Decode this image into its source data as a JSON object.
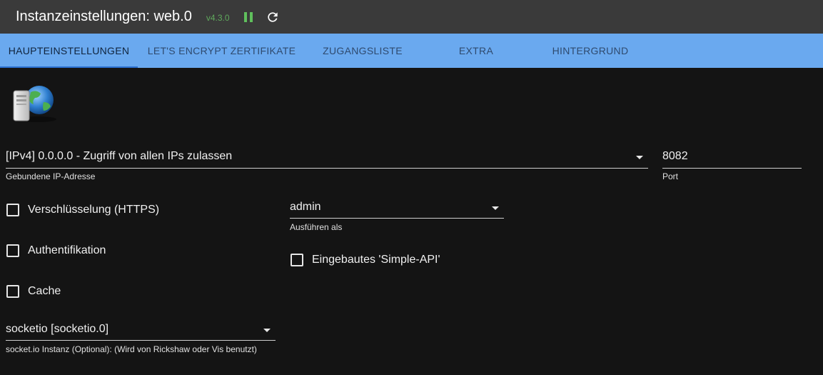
{
  "titlebar": {
    "title": "Instanzeinstellungen: web.0",
    "version": "v4.3.0"
  },
  "tabs": [
    {
      "label": "HAUPTEINSTELLUNGEN",
      "active": true
    },
    {
      "label": "LET'S ENCRYPT ZERTIFIKATE",
      "active": false
    },
    {
      "label": "ZUGANGSLISTE",
      "active": false
    },
    {
      "label": "EXTRA",
      "active": false
    },
    {
      "label": "HINTERGRUND",
      "active": false
    }
  ],
  "main": {
    "bind_ip": {
      "value": "[IPv4] 0.0.0.0 - Zugriff von allen IPs zulassen",
      "label": "Gebundene IP-Adresse"
    },
    "port": {
      "value": "8082",
      "label": "Port"
    },
    "https": {
      "label": "Verschlüsselung (HTTPS)",
      "checked": false
    },
    "auth": {
      "label": "Authentifikation",
      "checked": false
    },
    "cache": {
      "label": "Cache",
      "checked": false
    },
    "run_as": {
      "value": "admin",
      "label": "Ausführen als"
    },
    "simple_api": {
      "label": "Eingebautes 'Simple-API'",
      "checked": false
    },
    "socketio": {
      "value": "socketio [socketio.0]",
      "label": "socket.io Instanz (Optional): (Wird von Rickshaw oder Vis benutzt)"
    }
  },
  "colors": {
    "titlebar_bg": "#3a3a3a",
    "tabbar_bg": "#6aa9ef",
    "page_bg": "#141414",
    "version_green": "#5fa85c"
  },
  "icons": [
    "pause-icon",
    "reload-icon",
    "web-server-globe-icon",
    "dropdown-arrow-icon"
  ]
}
